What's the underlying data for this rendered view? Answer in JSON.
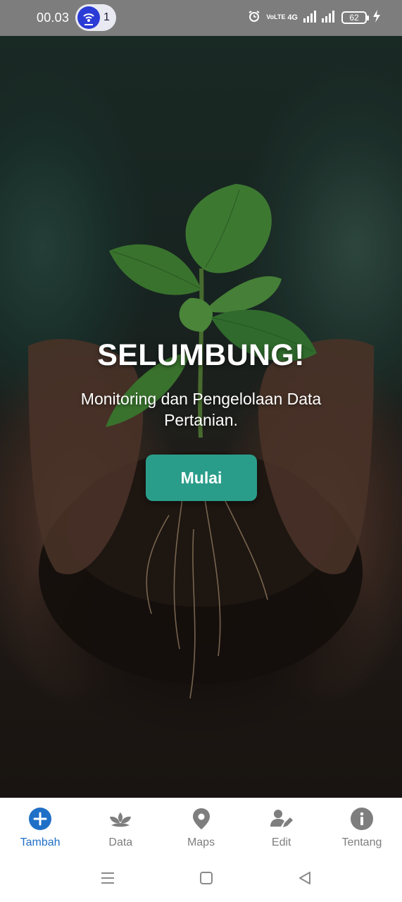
{
  "status_bar": {
    "time": "00.03",
    "hotspot_count": "1",
    "network_label": "4G",
    "volte_label": "VoLTE",
    "battery": "62",
    "icons": [
      "hotspot-icon",
      "alarm-icon",
      "signal-icon",
      "battery-icon",
      "charging-icon"
    ]
  },
  "hero": {
    "title": "SELUMBUNG!",
    "subtitle": "Monitoring dan Pengelolaan Data Pertanian.",
    "start_button": "Mulai"
  },
  "colors": {
    "accent": "#2a9d8a",
    "active_nav": "#1f6fc7",
    "inactive_nav": "#7e7e7e"
  },
  "bottom_nav": {
    "items": [
      {
        "label": "Tambah",
        "icon": "plus-circle-icon",
        "active": true
      },
      {
        "label": "Data",
        "icon": "plant-icon",
        "active": false
      },
      {
        "label": "Maps",
        "icon": "map-pin-icon",
        "active": false
      },
      {
        "label": "Edit",
        "icon": "user-edit-icon",
        "active": false
      },
      {
        "label": "Tentang",
        "icon": "info-icon",
        "active": false
      }
    ]
  },
  "system_nav": {
    "icons": [
      "menu-icon",
      "home-icon",
      "back-icon"
    ]
  }
}
